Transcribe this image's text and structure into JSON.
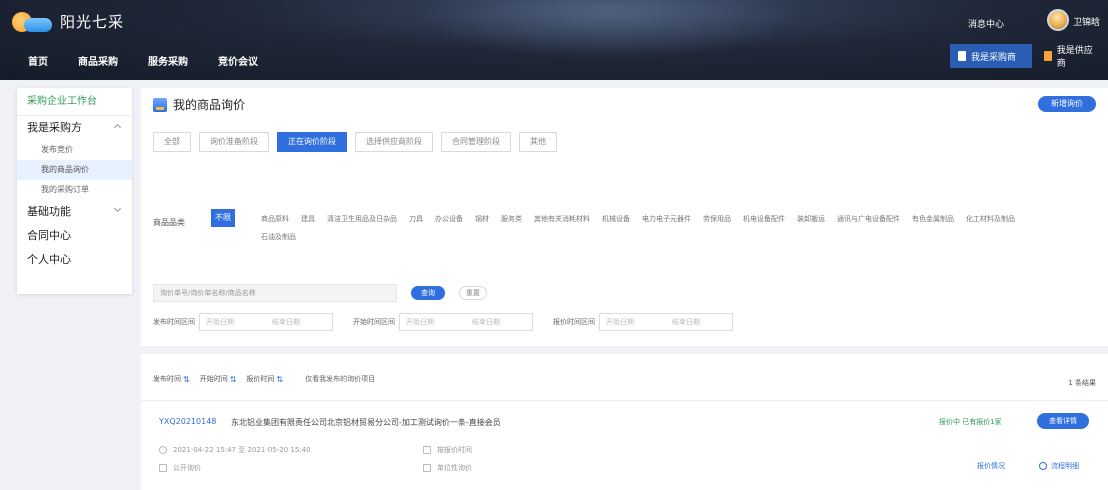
{
  "header": {
    "logo_text": "阳光七采",
    "nav": [
      "首页",
      "商品采购",
      "服务采购",
      "竞价会议"
    ],
    "message": "消息中心",
    "user": "卫锦晗",
    "role_buyer": "我是采购商",
    "role_seller": "我是供应商"
  },
  "sidebar": {
    "home": "采购企业工作台",
    "groups": [
      {
        "label": "我是采购方",
        "items": [
          "发布竞价",
          "我的商品询价",
          "我的采购订单"
        ]
      },
      {
        "label": "基础功能"
      },
      {
        "label": "合同中心"
      },
      {
        "label": "个人中心"
      }
    ]
  },
  "main": {
    "title": "我的商品询价",
    "new_button": "新增询价",
    "stage_tabs": [
      "全部",
      "询价准备阶段",
      "正在询价阶段",
      "选择供应商阶段",
      "合同管理阶段",
      "其他"
    ],
    "active_stage": 2,
    "category_label": "商品品类",
    "category_all": "不限",
    "categories": [
      "商品原料",
      "建具",
      "清洁卫生用品及日杂品",
      "刀具",
      "办公设备",
      "钢材",
      "服务类",
      "其他有关消耗材料",
      "机械设备",
      "电力电子元器件",
      "劳保用品",
      "机电设备配件",
      "装卸搬运",
      "通讯与广电设备配件",
      "有色金属制品",
      "化工材料及制品",
      "石油及制品"
    ],
    "search_placeholder": "询价单号/询价单名称/商品名称",
    "search_button": "查询",
    "reset_button": "重置",
    "date_ranges": [
      {
        "label": "发布时间区间",
        "start": "开始日期",
        "end": "结束日期"
      },
      {
        "label": "开始时间区间",
        "start": "开始日期",
        "end": "结束日期"
      },
      {
        "label": "报价时间区间",
        "start": "开始日期",
        "end": "结束日期"
      }
    ],
    "sorts": [
      "发布时间",
      "开始时间",
      "报价时间"
    ],
    "sort_check": "仅看我发布的询价项目",
    "total": "1 条结果",
    "card": {
      "id": "YXQ20210148",
      "title": "东北铝业集团有限责任公司北京铝材贸易分公司-加工测试询价一条-直接会员",
      "status": "报价中 已有报价1家",
      "button": "查看详情",
      "time": "2021-04-22 15:47 至 2021-05-20 15:40",
      "type": "公开询价",
      "rule": "按报价时间",
      "mode": "单位性询价",
      "link1": "报价情况",
      "link2": "流程明细"
    }
  }
}
